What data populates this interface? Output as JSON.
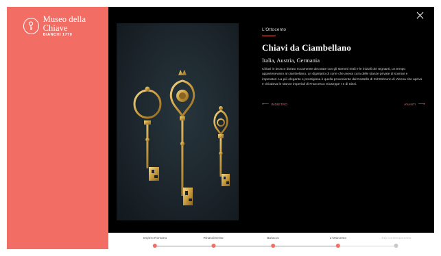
{
  "brand": {
    "name": "Museo della Chiave",
    "sub": "BIANCHI 1770"
  },
  "detail": {
    "era": "L'Ottocento",
    "title": "Chiavi da Ciambellano",
    "subtitle": "Italia, Austria, Germania",
    "description": "Chiavi in bronzo dorato riccamente decorate con gli stemmi reali e le iniziali dei regnanti, un tempo appartenevano al ciambellano, un dignitario di corte che aveva cura delle stanze private di sovrani e imperatori. La più elegante e prestigiosa è quella proveniente dal Castello di Schönbrunn di Vienna che apriva e chiudeva le stanze imperiali di Francesco Giuseppe I e di Sissi.",
    "prev_label": "INDIETRO",
    "next_label": "AVANTI"
  },
  "timeline": {
    "items": [
      {
        "label": "Impero Romano",
        "state": "done"
      },
      {
        "label": "Rinascimento",
        "state": "done"
      },
      {
        "label": "Barocco",
        "state": "done"
      },
      {
        "label": "L'Ottocento",
        "state": "current"
      },
      {
        "label": "Età Contemporanea",
        "state": "upcoming"
      }
    ]
  },
  "colors": {
    "accent": "#f26e65",
    "background": "#000000",
    "inactive": "#c8c8c8"
  },
  "icons": {
    "close": "close-icon",
    "logo": "key-hole-icon",
    "prev": "arrow-left-icon",
    "next": "arrow-right-icon"
  }
}
